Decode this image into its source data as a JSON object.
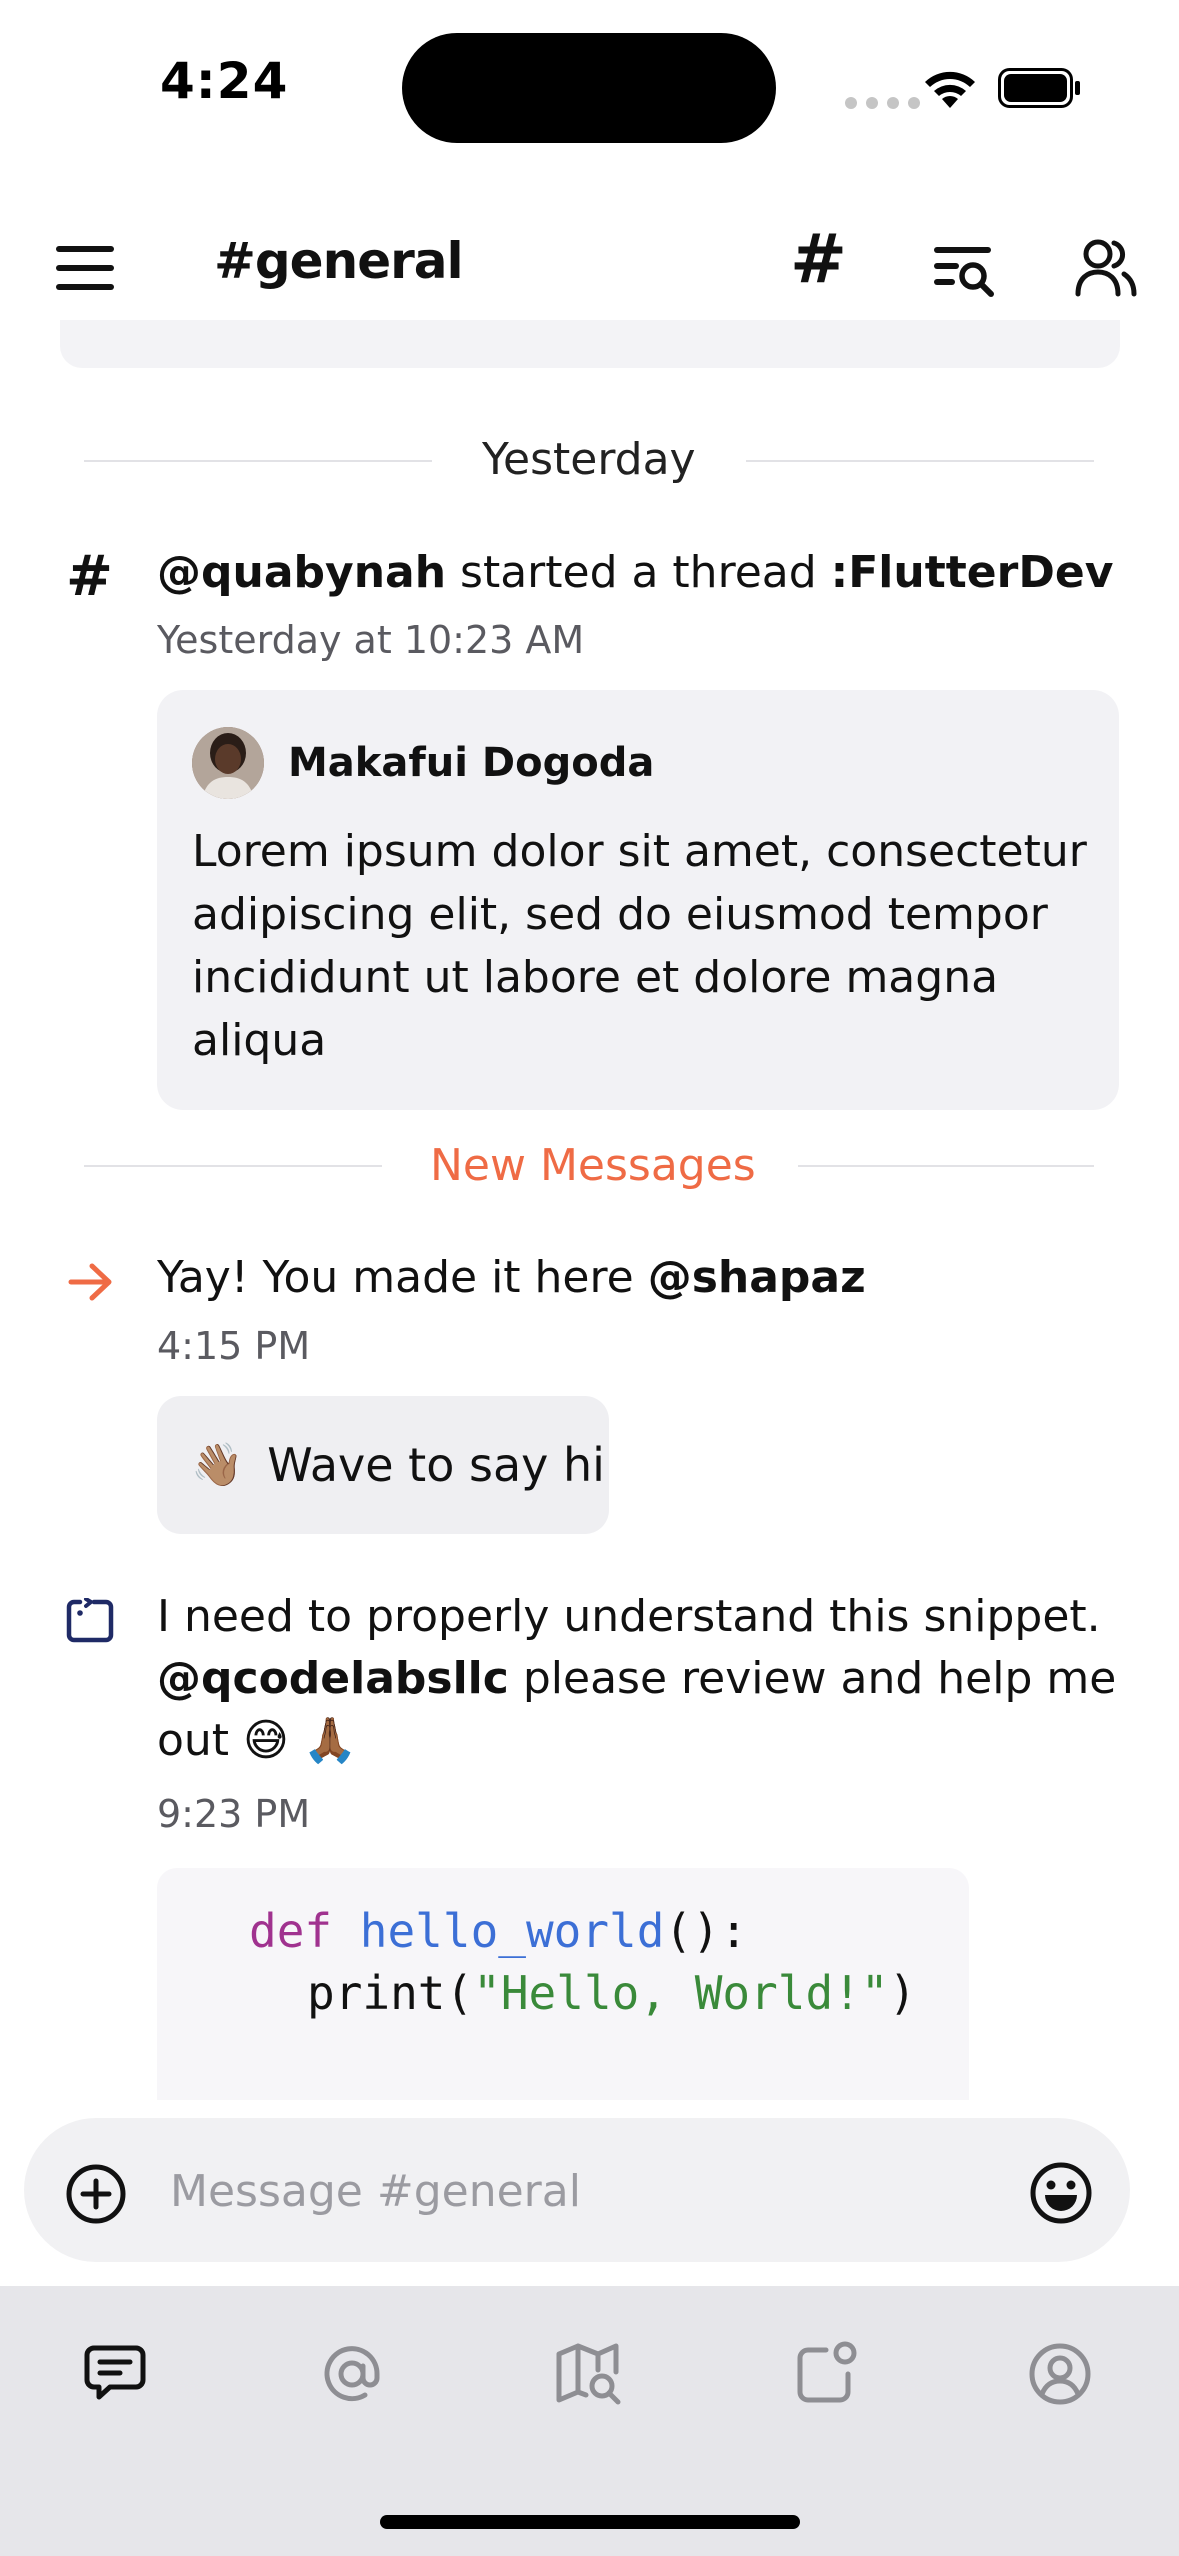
{
  "status_bar": {
    "time": "4:24",
    "icons": [
      "cellular-icon",
      "wifi-icon",
      "battery-icon"
    ]
  },
  "header": {
    "title": "#general",
    "icons": [
      "menu-icon",
      "channel-hash-icon",
      "search-list-icon",
      "members-icon"
    ]
  },
  "feed": {
    "date_divider": "Yesterday",
    "thread_message": {
      "icon": "hash-icon",
      "mention": "@quabynah",
      "action": " started a thread ",
      "thread_name": ":FlutterDev",
      "time": "Yesterday at 10:23 AM",
      "quote": {
        "author": "Makafui Dogoda",
        "text": "Lorem ipsum dolor sit amet, consectetur adipiscing elit, sed do eiusmod tempor incididunt ut labore et dolore magna aliqua"
      }
    },
    "new_divider": "New Messages",
    "join_message": {
      "icon": "arrow-right-icon",
      "text": "Yay! You made it here ",
      "mention": "@shapaz",
      "time": "4:15 PM",
      "wave_emoji": "👋🏽",
      "wave_label": "Wave to say hi"
    },
    "snippet_message": {
      "icon": "snippet-icon",
      "text_line1": "I need to properly understand this snippet.",
      "mention": "@qcodelabsllc",
      "text_line2": " please review and help me",
      "text_line3": "out 😅 🙏🏾",
      "time": "9:23 PM",
      "code": {
        "kw": "def",
        "fn": "hello_world",
        "sig_rest": "():",
        "call": "print(",
        "str": "\"Hello, World!\"",
        "close": ")"
      }
    }
  },
  "composer": {
    "placeholder": "Message #general",
    "left_icon": "add-circle-icon",
    "right_icon": "emoji-icon"
  },
  "tab_bar": {
    "tabs": [
      "chat-icon",
      "mentions-icon",
      "discover-map-icon",
      "notifications-icon",
      "profile-icon"
    ],
    "active": "chat-icon"
  },
  "colors": {
    "accent": "#ef6b45",
    "snippet_icon": "#1f2a66"
  }
}
